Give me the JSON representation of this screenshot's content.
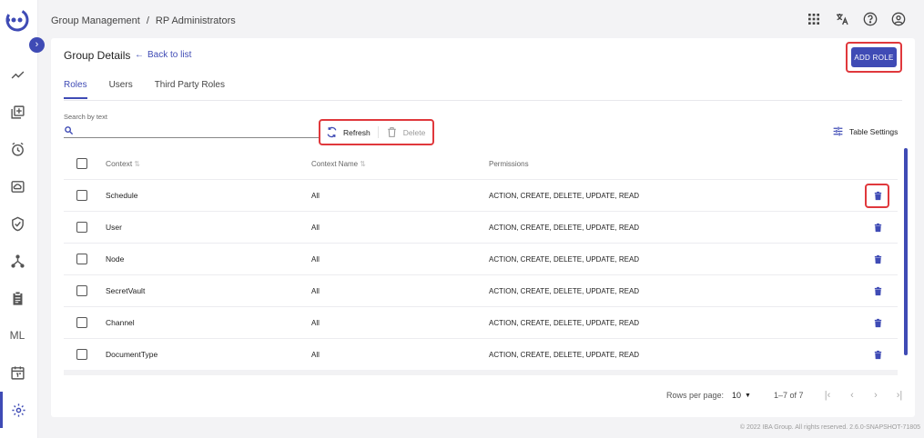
{
  "breadcrumb": {
    "root": "Group Management",
    "sep": "/",
    "current": "RP Administrators"
  },
  "topbar": {
    "icons": [
      "apps-grid-icon",
      "translate-icon",
      "help-icon",
      "account-icon"
    ]
  },
  "sidebar": {
    "items": [
      {
        "name": "trending-icon"
      },
      {
        "name": "library-add-icon"
      },
      {
        "name": "alarm-icon"
      },
      {
        "name": "cloud-storage-icon"
      },
      {
        "name": "shield-check-icon"
      },
      {
        "name": "hierarchy-icon"
      },
      {
        "name": "clipboard-icon"
      },
      {
        "name": "ml",
        "label": "ML"
      },
      {
        "name": "calendar-icon"
      },
      {
        "name": "settings-icon",
        "active": true
      }
    ]
  },
  "card": {
    "title": "Group Details",
    "back": "Back to list",
    "add_role": "ADD ROLE",
    "tabs": [
      {
        "label": "Roles",
        "active": true
      },
      {
        "label": "Users"
      },
      {
        "label": "Third Party Roles"
      }
    ],
    "search_label": "Search by text",
    "search_value": "",
    "refresh": "Refresh",
    "delete": "Delete",
    "table_settings": "Table Settings"
  },
  "table": {
    "headers": {
      "context": "Context",
      "context_name": "Context Name",
      "permissions": "Permissions"
    },
    "rows": [
      {
        "context": "Schedule",
        "name": "All",
        "perm": "ACTION, CREATE, DELETE, UPDATE, READ",
        "highlighted": true
      },
      {
        "context": "User",
        "name": "All",
        "perm": "ACTION, CREATE, DELETE, UPDATE, READ"
      },
      {
        "context": "Node",
        "name": "All",
        "perm": "ACTION, CREATE, DELETE, UPDATE, READ"
      },
      {
        "context": "SecretVault",
        "name": "All",
        "perm": "ACTION, CREATE, DELETE, UPDATE, READ"
      },
      {
        "context": "Channel",
        "name": "All",
        "perm": "ACTION, CREATE, DELETE, UPDATE, READ"
      },
      {
        "context": "DocumentType",
        "name": "All",
        "perm": "ACTION, CREATE, DELETE, UPDATE, READ"
      }
    ]
  },
  "pagination": {
    "rows_label": "Rows per page:",
    "rows_value": "10",
    "range": "1–7 of 7"
  },
  "footer": "© 2022 IBA Group. All rights reserved. 2.6.0-SNAPSHOT-71805",
  "colors": {
    "accent": "#3f4bb5",
    "highlight": "#e0383c"
  }
}
